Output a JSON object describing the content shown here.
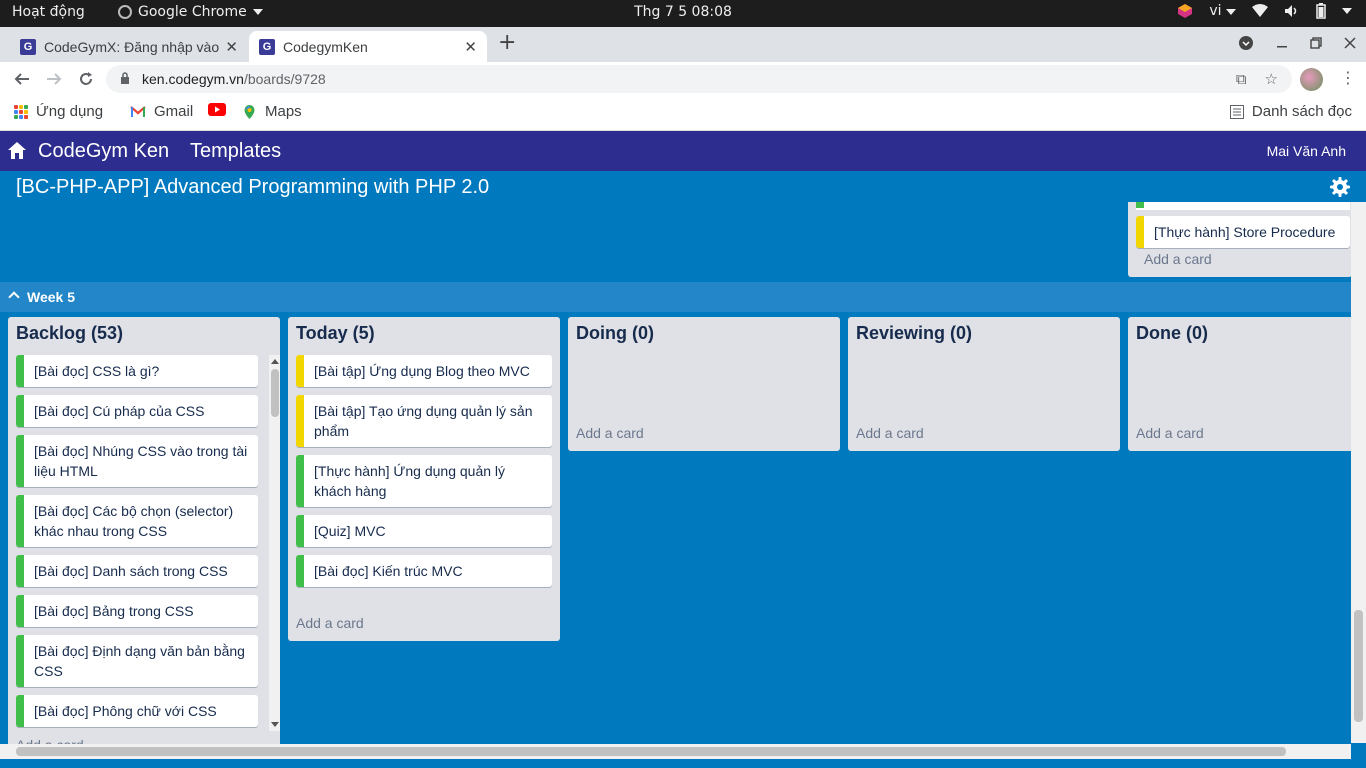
{
  "os_bar": {
    "activities": "Hoạt động",
    "app_name": "Google Chrome",
    "clock": "Thg 7 5  08:08",
    "lang": "vi"
  },
  "browser": {
    "tabs": [
      {
        "title": "CodeGymX: Đăng nhập vào",
        "active": false
      },
      {
        "title": "CodegymKen",
        "active": true
      }
    ],
    "url_host": "ken.codegym.vn",
    "url_path": "/boards/9728",
    "bookmarks": [
      {
        "label": "Ứng dụng",
        "icon": "apps-grid-icon"
      },
      {
        "label": "Gmail",
        "icon": "gmail-icon"
      },
      {
        "label": "",
        "icon": "youtube-icon"
      },
      {
        "label": "Maps",
        "icon": "maps-icon"
      }
    ],
    "reading_list": "Danh sách đọc"
  },
  "app": {
    "brand": "CodeGym Ken",
    "templates": "Templates",
    "user": "Mai Văn Anh",
    "board_title": "[BC-PHP-APP] Advanced Programming with PHP 2.0"
  },
  "previous_lane": {
    "card": "[Thực hành] Store Procedure",
    "add_card": "Add a card"
  },
  "swimlane": {
    "label": "Week 5"
  },
  "lists": {
    "backlog": {
      "title": "Backlog (53)",
      "cards": [
        {
          "text": "[Bài đọc] CSS là gì?",
          "color": "#3fbf4a"
        },
        {
          "text": "[Bài đọc] Cú pháp của CSS",
          "color": "#3fbf4a"
        },
        {
          "text": "[Bài đọc] Nhúng CSS vào trong tài liệu HTML",
          "color": "#3fbf4a"
        },
        {
          "text": "[Bài đọc] Các bộ chọn (selector) khác nhau trong CSS",
          "color": "#3fbf4a"
        },
        {
          "text": "[Bài đọc] Danh sách trong CSS",
          "color": "#3fbf4a"
        },
        {
          "text": "[Bài đọc] Bảng trong CSS",
          "color": "#3fbf4a"
        },
        {
          "text": "[Bài đọc] Định dạng văn bản bằng CSS",
          "color": "#3fbf4a"
        },
        {
          "text": "[Bài đọc] Phông chữ với CSS",
          "color": "#3fbf4a"
        }
      ],
      "add_card": "Add a card"
    },
    "today": {
      "title": "Today (5)",
      "cards": [
        {
          "text": "[Bài tập] Ứng dụng Blog theo MVC",
          "color": "#f2d600"
        },
        {
          "text": "[Bài tập] Tạo ứng dụng quản lý sản phẩm",
          "color": "#f2d600"
        },
        {
          "text": "[Thực hành] Ứng dụng quản lý khách hàng",
          "color": "#3fbf4a"
        },
        {
          "text": "[Quiz] MVC",
          "color": "#3fbf4a"
        },
        {
          "text": "[Bài đọc] Kiến trúc MVC",
          "color": "#3fbf4a"
        }
      ],
      "add_card": "Add a card"
    },
    "doing": {
      "title": "Doing (0)",
      "add_card": "Add a card"
    },
    "reviewing": {
      "title": "Reviewing (0)",
      "add_card": "Add a card"
    },
    "done": {
      "title": "Done (0)",
      "add_card": "Add a card"
    }
  }
}
